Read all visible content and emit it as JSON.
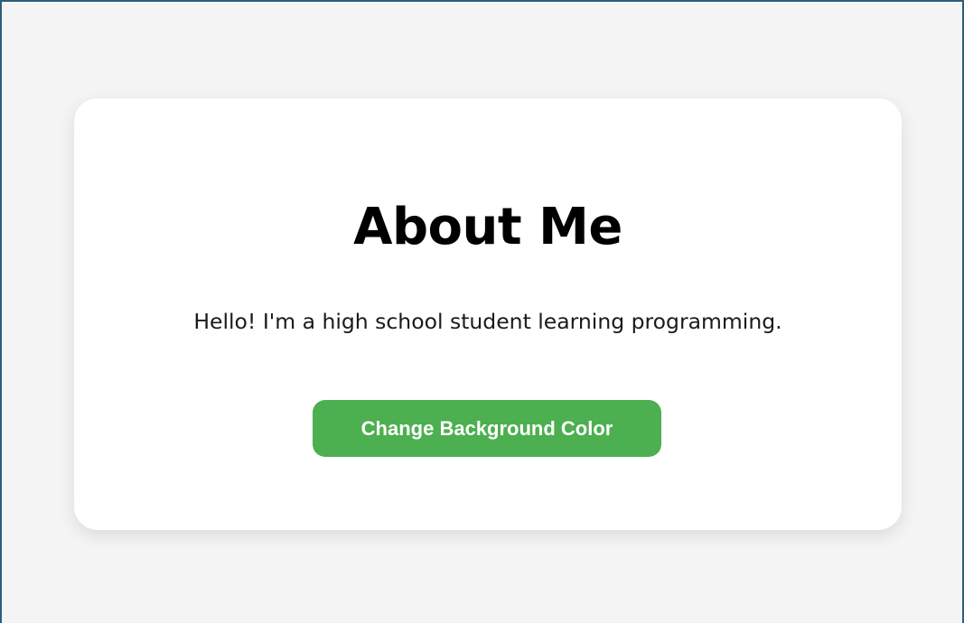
{
  "card": {
    "title": "About Me",
    "bio": "Hello! I'm a high school student learning programming.",
    "button_label": "Change Background Color"
  },
  "colors": {
    "page_background": "#f4f4f4",
    "card_background": "#ffffff",
    "button_background": "#4caf50",
    "button_text": "#ffffff"
  }
}
